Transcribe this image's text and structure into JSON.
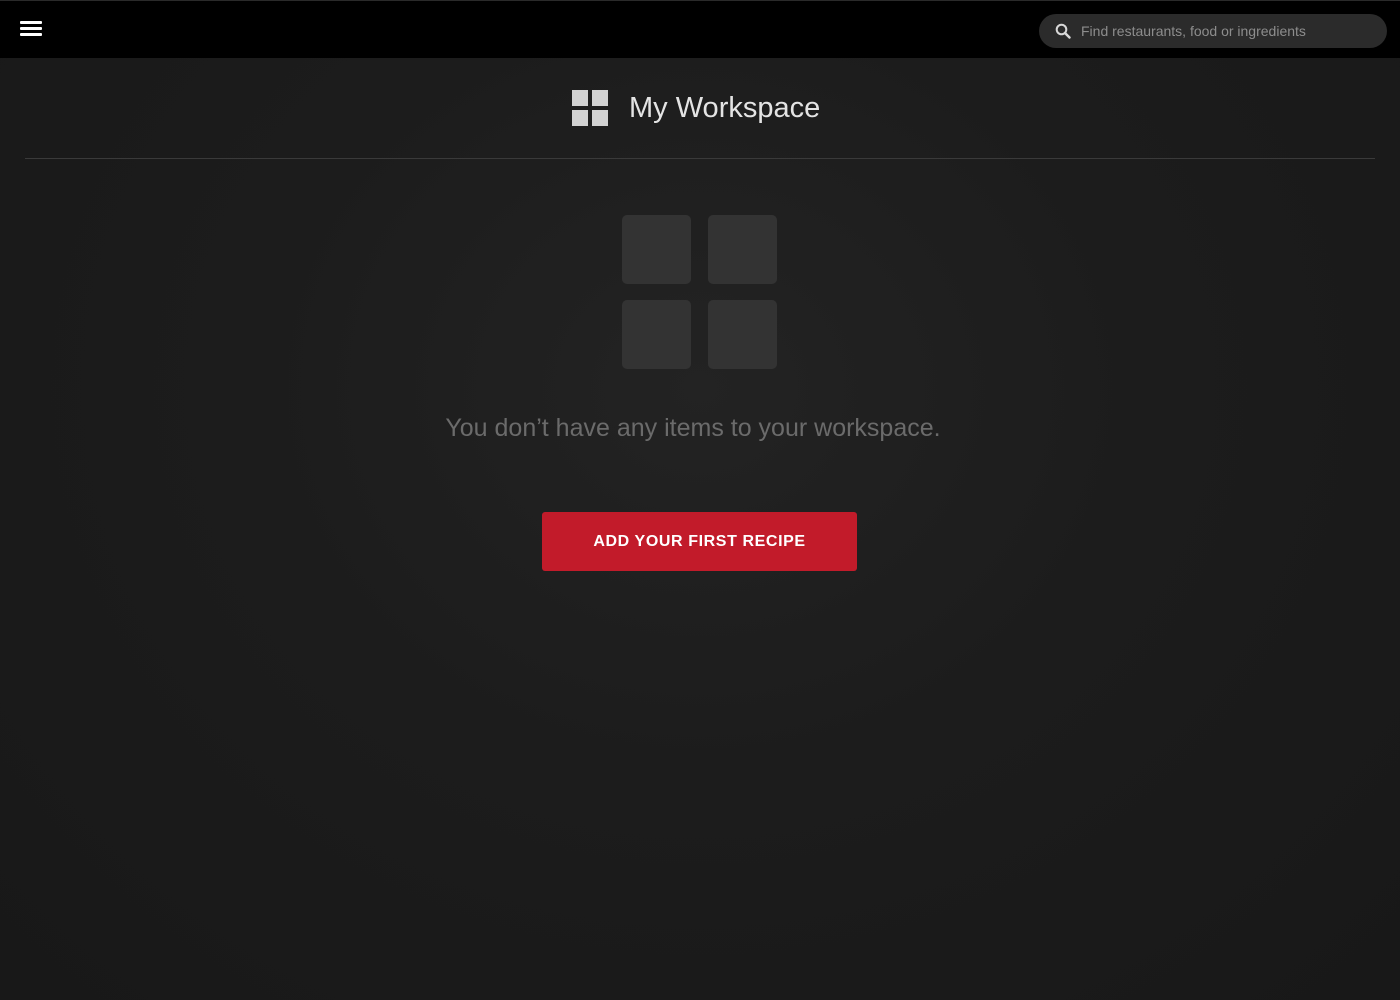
{
  "topbar": {
    "menu_icon": "hamburger-menu-icon",
    "search": {
      "icon": "search-icon",
      "placeholder": "Find restaurants, food or ingredients",
      "value": ""
    }
  },
  "header": {
    "icon": "workspace-grid-icon",
    "title": "My Workspace"
  },
  "empty_state": {
    "icon": "empty-workspace-grid-icon",
    "message": "You don’t have any items to your workspace.",
    "button_label": "ADD YOUR FIRST RECIPE"
  },
  "colors": {
    "topbar_background": "#000000",
    "page_background": "#1b1b1b",
    "accent_button": "#c21b2a",
    "title_text": "#e4e4e4",
    "muted_text": "#6b6b6b",
    "empty_tile": "#333333"
  }
}
